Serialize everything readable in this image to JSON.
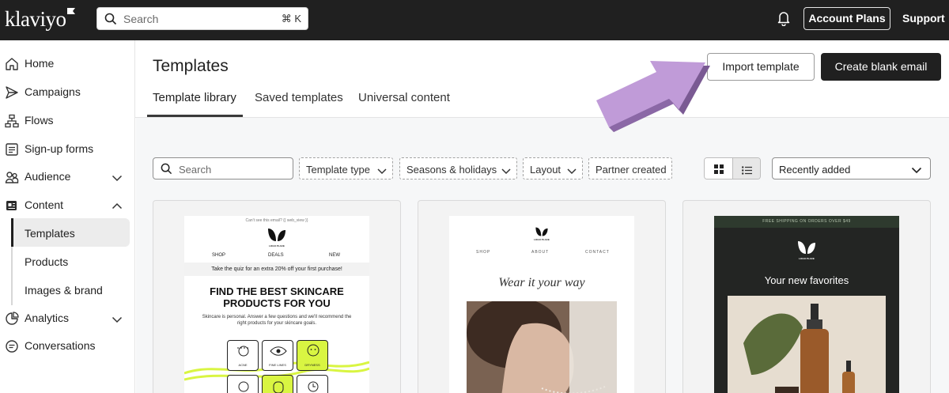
{
  "app": {
    "logo_text": "klaviyo"
  },
  "topbar": {
    "search_placeholder": "Search",
    "search_shortcut": "⌘ K",
    "account_label": "Account Plans",
    "support_label": "Support"
  },
  "sidebar": {
    "items": [
      {
        "label": "Home",
        "icon": "home-icon"
      },
      {
        "label": "Campaigns",
        "icon": "send-icon"
      },
      {
        "label": "Flows",
        "icon": "flow-icon"
      },
      {
        "label": "Sign-up forms",
        "icon": "form-icon"
      },
      {
        "label": "Audience",
        "icon": "people-icon"
      },
      {
        "label": "Content",
        "icon": "content-icon"
      },
      {
        "label": "Analytics",
        "icon": "chart-icon"
      },
      {
        "label": "Conversations",
        "icon": "chat-icon"
      }
    ],
    "content_subitems": [
      {
        "label": "Templates"
      },
      {
        "label": "Products"
      },
      {
        "label": "Images & brand"
      }
    ]
  },
  "page": {
    "title": "Templates",
    "import_label": "Import template",
    "create_label": "Create blank email",
    "tabs": [
      {
        "label": "Template library"
      },
      {
        "label": "Saved templates"
      },
      {
        "label": "Universal content"
      }
    ]
  },
  "filters": {
    "search_placeholder": "Search",
    "dropdowns": [
      {
        "label": "Template type"
      },
      {
        "label": "Seasons & holidays"
      },
      {
        "label": "Layout"
      },
      {
        "label": "Partner created"
      }
    ],
    "sort_value": "Recently added"
  },
  "cards": {
    "card1": {
      "top_note": "Can't see this email? {{ web_view }}",
      "logo_text": "LOGO PLACE",
      "nav": [
        "SHOP",
        "DEALS",
        "NEW"
      ],
      "band": "Take the quiz for an extra 20% off your first purchase!",
      "headline": "FIND THE BEST SKINCARE PRODUCTS FOR YOU",
      "body": "Skincare is personal. Answer a few questions and we'll recommend the right products for your skincare goals.",
      "tiles": [
        "ACNE",
        "FINE LINES",
        "DRYNESS"
      ]
    },
    "card2": {
      "logo_text": "LOGO PLACE",
      "nav": [
        "SHOP",
        "ABOUT",
        "CONTACT"
      ],
      "headline": "Wear it your way"
    },
    "card3": {
      "shipping": "FREE SHIPPING ON ORDERS OVER $49",
      "logo_text": "LOGO PLACE",
      "headline": "Your new favorites"
    }
  },
  "colors": {
    "topbar": "#202020",
    "annotation_arrow": "#b58fd0",
    "quiz_highlight": "#d9f542"
  }
}
